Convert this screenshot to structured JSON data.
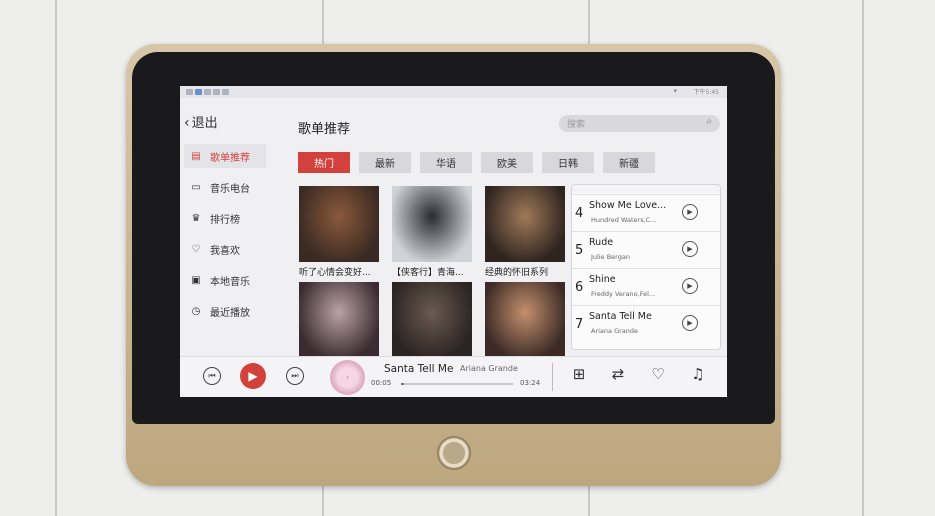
{
  "status_bar": {
    "time": "下午5:45",
    "wifi_icon": "wifi-icon"
  },
  "sidebar": {
    "back_label": "退出",
    "items": [
      {
        "label": "歌单推荐",
        "icon": "playlist-icon",
        "glyph": "▤",
        "active": true
      },
      {
        "label": "音乐电台",
        "icon": "radio-icon",
        "glyph": "▭",
        "active": false
      },
      {
        "label": "排行榜",
        "icon": "trophy-icon",
        "glyph": "♛",
        "active": false
      },
      {
        "label": "我喜欢",
        "icon": "heart-icon",
        "glyph": "♡",
        "active": false
      },
      {
        "label": "本地音乐",
        "icon": "local-music-icon",
        "glyph": "▣",
        "active": false
      },
      {
        "label": "最近播放",
        "icon": "clock-icon",
        "glyph": "◷",
        "active": false
      }
    ]
  },
  "header": {
    "title": "歌单推荐",
    "search_placeholder": "搜索"
  },
  "tabs": [
    {
      "label": "热门",
      "active": true
    },
    {
      "label": "最新",
      "active": false
    },
    {
      "label": "华语",
      "active": false
    },
    {
      "label": "欧美",
      "active": false
    },
    {
      "label": "日韩",
      "active": false
    },
    {
      "label": "新疆",
      "active": false
    }
  ],
  "playlists": [
    {
      "caption": "听了心情会变好...",
      "colors": [
        "#3a2a24",
        "#8a5a3a"
      ]
    },
    {
      "caption": "【侠客行】青海...",
      "colors": [
        "#cfd3d8",
        "#2b2b30"
      ]
    },
    {
      "caption": "经典的怀旧系列",
      "colors": [
        "#2e2420",
        "#a07a58"
      ]
    },
    {
      "caption": "",
      "colors": [
        "#3a2c30",
        "#b9a1a8"
      ]
    },
    {
      "caption": "",
      "colors": [
        "#2a2422",
        "#6a5a52"
      ]
    },
    {
      "caption": "",
      "colors": [
        "#3b2a26",
        "#c4906e"
      ]
    }
  ],
  "songs": [
    {
      "num": "4",
      "title": "Show Me Love...",
      "artist": "Hundred Waters,C..."
    },
    {
      "num": "5",
      "title": "Rude",
      "artist": "Julie Bergan"
    },
    {
      "num": "6",
      "title": "Shine",
      "artist": "Freddy Verano,Fel..."
    },
    {
      "num": "7",
      "title": "Santa Tell Me",
      "artist": "Ariana Grande"
    }
  ],
  "player": {
    "title": "Santa Tell Me",
    "artist": "Ariana Grande",
    "current": "00:05",
    "duration": "03:24",
    "progress": 0.024,
    "accent": "#d2413c"
  }
}
